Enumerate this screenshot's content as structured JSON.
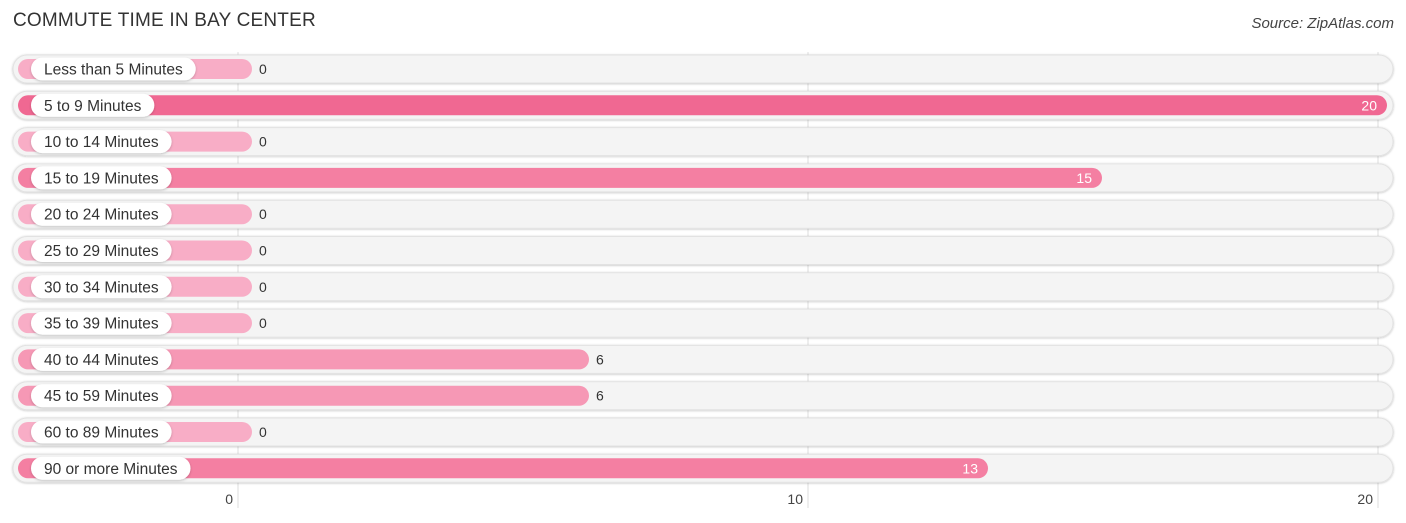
{
  "header": {
    "title": "COMMUTE TIME IN BAY CENTER",
    "source": "Source: ZipAtlas.com"
  },
  "chart_data": {
    "type": "bar",
    "orientation": "horizontal",
    "title": "COMMUTE TIME IN BAY CENTER",
    "xlabel": "",
    "ylabel": "",
    "categories": [
      "Less than 5 Minutes",
      "5 to 9 Minutes",
      "10 to 14 Minutes",
      "15 to 19 Minutes",
      "20 to 24 Minutes",
      "25 to 29 Minutes",
      "30 to 34 Minutes",
      "35 to 39 Minutes",
      "40 to 44 Minutes",
      "45 to 59 Minutes",
      "60 to 89 Minutes",
      "90 or more Minutes"
    ],
    "values": [
      0,
      20,
      0,
      15,
      0,
      0,
      0,
      0,
      6,
      6,
      0,
      13
    ],
    "xlim": [
      0,
      20
    ],
    "xticks": [
      0,
      10,
      20
    ],
    "grid": true,
    "colors": {
      "max": "#f06892",
      "high": "#f47fa2",
      "mid": "#f698b5",
      "zero": "#f8adc6",
      "track": "#f4f4f4"
    }
  }
}
